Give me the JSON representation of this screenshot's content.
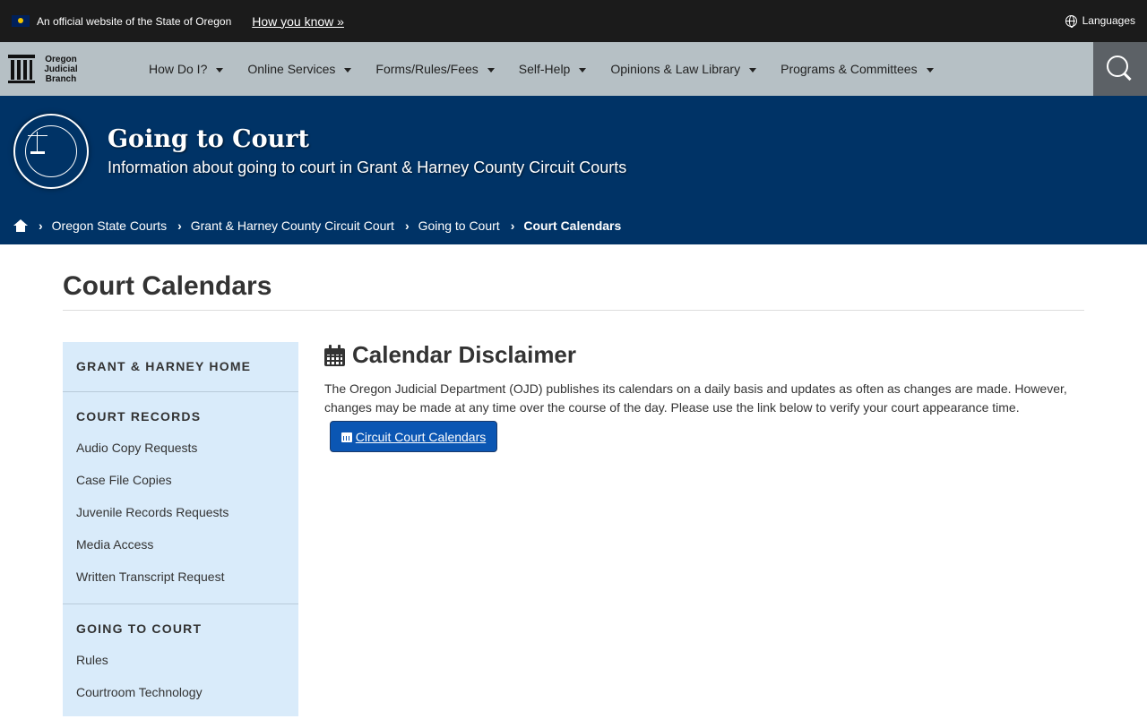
{
  "official": {
    "text": "An official website of the State of Oregon",
    "how_you_know": "How you know »",
    "languages": "Languages"
  },
  "brand": {
    "line1": "Oregon",
    "line2": "Judicial",
    "line3": "Branch"
  },
  "nav": {
    "items": [
      {
        "label": "How Do I?"
      },
      {
        "label": "Online Services"
      },
      {
        "label": "Forms/Rules/Fees"
      },
      {
        "label": "Self-Help"
      },
      {
        "label": "Opinions & Law Library"
      },
      {
        "label": "Programs & Committees"
      }
    ]
  },
  "hero": {
    "title": "Going to Court",
    "subtitle": "Information about going to court in Grant & Harney County Circuit Courts"
  },
  "breadcrumb": {
    "items": [
      {
        "label": "Oregon State Courts"
      },
      {
        "label": "Grant & Harney County Circuit Court"
      },
      {
        "label": "Going to Court"
      },
      {
        "label": "Court Calendars"
      }
    ]
  },
  "page": {
    "title": "Court Calendars"
  },
  "sidebar": {
    "home": "GRANT & HARNEY HOME",
    "sections": [
      {
        "title": "COURT RECORDS",
        "links": [
          "Audio Copy Requests",
          "Case File Copies",
          "Juvenile Records Requests",
          "Media Access",
          "Written Transcript Request"
        ]
      },
      {
        "title": "GOING TO COURT",
        "links": [
          "Rules",
          "Courtroom Technology"
        ]
      }
    ]
  },
  "disclaimer": {
    "title": "Calendar Disclaimer",
    "text": "The Oregon Judicial Department (OJD) publishes its calendars on a daily basis and updates as often as changes are made. However, changes may be made at any time over the course of the day. Please use the link below to verify your court appearance time.",
    "button_label": "Circuit Court Calendars"
  },
  "colors": {
    "official_bar": "#1b1b1b",
    "nav_bg": "#b6c0c5",
    "search_bg": "#5c6166",
    "hero_bg": "#003366",
    "sidebar_bg": "#d9ebfa",
    "button_bg": "#0b56b3"
  }
}
